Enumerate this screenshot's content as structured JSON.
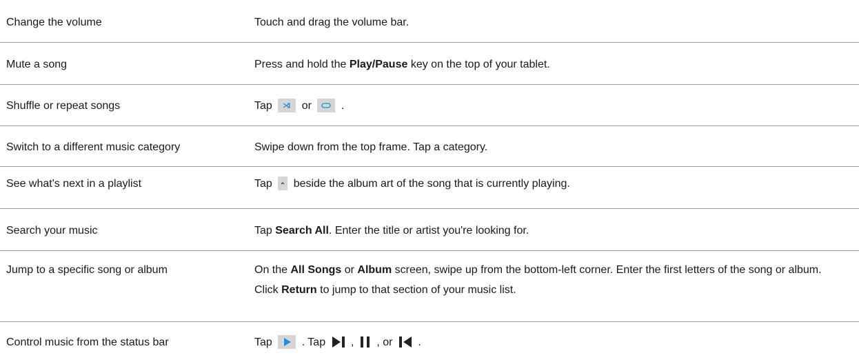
{
  "rows": [
    {
      "task": "Change the volume",
      "segments": [
        {
          "type": "text",
          "text": "Touch and drag the volume bar."
        }
      ]
    },
    {
      "task": "Mute a song",
      "segments": [
        {
          "type": "text",
          "text": "Press and hold the "
        },
        {
          "type": "bold",
          "text": "Play/Pause"
        },
        {
          "type": "text",
          "text": " key on the top of your tablet."
        }
      ]
    },
    {
      "task": "Shuffle or repeat songs",
      "segments": [
        {
          "type": "text",
          "text": "Tap "
        },
        {
          "type": "icon",
          "icon": "shuffle-icon"
        },
        {
          "type": "text",
          "text": " or "
        },
        {
          "type": "icon",
          "icon": "repeat-icon"
        },
        {
          "type": "text",
          "text": " ."
        }
      ]
    },
    {
      "task": "Switch to a different music category",
      "segments": [
        {
          "type": "text",
          "text": "Swipe down from the top frame. Tap a category."
        }
      ]
    },
    {
      "task": "See what's next in a playlist",
      "segments": [
        {
          "type": "text",
          "text": "Tap "
        },
        {
          "type": "icon",
          "icon": "up-arrow-icon"
        },
        {
          "type": "text",
          "text": " beside the album art of the song that is currently playing."
        }
      ]
    },
    {
      "task": "Search your music",
      "segments": [
        {
          "type": "text",
          "text": "Tap "
        },
        {
          "type": "bold",
          "text": "Search All"
        },
        {
          "type": "text",
          "text": ". Enter the title or artist you're looking for."
        }
      ]
    },
    {
      "task": "Jump to a specific song or album",
      "segments": [
        {
          "type": "text",
          "text": "On the "
        },
        {
          "type": "bold",
          "text": "All Songs"
        },
        {
          "type": "text",
          "text": " or "
        },
        {
          "type": "bold",
          "text": "Album"
        },
        {
          "type": "text",
          "text": " screen, swipe up from the bottom-left corner. Enter the first letters of the song or album. Click "
        },
        {
          "type": "bold",
          "text": "Return"
        },
        {
          "type": "text",
          "text": " to jump to that section of your music list."
        }
      ]
    },
    {
      "task": "Control music from the status bar",
      "segments": [
        {
          "type": "text",
          "text": "Tap "
        },
        {
          "type": "icon",
          "icon": "play-status-icon"
        },
        {
          "type": "text",
          "text": " . Tap "
        },
        {
          "type": "icon",
          "icon": "next-track-icon"
        },
        {
          "type": "text",
          "text": " , "
        },
        {
          "type": "icon",
          "icon": "pause-icon"
        },
        {
          "type": "text",
          "text": " , or "
        },
        {
          "type": "icon",
          "icon": "previous-track-icon"
        },
        {
          "type": "text",
          "text": " ."
        }
      ]
    }
  ],
  "colors": {
    "text": "#1a1a1a",
    "divider": "#9a9a9a",
    "icon_box": "#d6d6d6",
    "icon_blue": "#1e90d8",
    "icon_dark": "#222222"
  }
}
